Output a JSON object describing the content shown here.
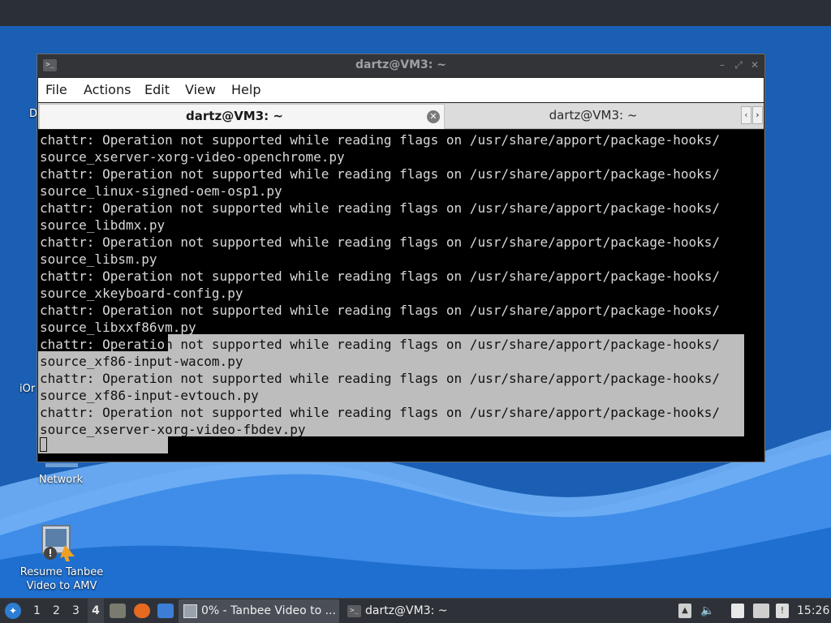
{
  "desktop": {
    "icons": {
      "network_label": "Network",
      "resume_label": "Resume Tanbee Video to AMV",
      "partial_d": "D",
      "partial_iorg": "iOr"
    }
  },
  "window": {
    "title": "dartz@VM3: ~",
    "controls": {
      "minimize": "–",
      "maximize": "⤢",
      "close": "✕"
    }
  },
  "menubar": {
    "file": "File",
    "actions": "Actions",
    "edit": "Edit",
    "view": "View",
    "help": "Help"
  },
  "tabs": [
    {
      "label": "dartz@VM3: ~",
      "active": true
    },
    {
      "label": "dartz@VM3: ~",
      "active": false
    }
  ],
  "terminal": {
    "lines": [
      "chattr: Operation not supported while reading flags on /usr/share/apport/package-hooks/",
      "source_xserver-xorg-video-openchrome.py",
      "chattr: Operation not supported while reading flags on /usr/share/apport/package-hooks/",
      "source_linux-signed-oem-osp1.py",
      "chattr: Operation not supported while reading flags on /usr/share/apport/package-hooks/",
      "source_libdmx.py",
      "chattr: Operation not supported while reading flags on /usr/share/apport/package-hooks/",
      "source_libsm.py",
      "chattr: Operation not supported while reading flags on /usr/share/apport/package-hooks/",
      "source_xkeyboard-config.py",
      "chattr: Operation not supported while reading flags on /usr/share/apport/package-hooks/",
      "source_libxxf86vm.py",
      "chattr: Operation not supported while reading flags on /usr/share/apport/package-hooks/",
      "source_xf86-input-wacom.py",
      "chattr: Operation not supported while reading flags on /usr/share/apport/package-hooks/",
      "source_xf86-input-evtouch.py",
      "chattr: Operation not supported while reading flags on /usr/share/apport/package-hooks/",
      "source_xserver-xorg-video-fbdev.py"
    ]
  },
  "taskbar": {
    "workspaces": [
      "1",
      "2",
      "3",
      "4"
    ],
    "active_workspace": "4",
    "tasks": {
      "tanbee": "0% - Tanbee Video to ...",
      "terminal": "dartz@VM3: ~"
    },
    "clock": "15:26",
    "icons": [
      "start-menu-icon",
      "file-manager-icon",
      "firefox-icon",
      "show-desktop-icon",
      "updates-icon",
      "volume-icon",
      "clipboard-icon",
      "network-icon",
      "alert-icon"
    ]
  },
  "colors": {
    "desktop_bg": "#1565c0",
    "terminal_bg": "#000000",
    "selection": "#bdbdbd",
    "taskbar": "#2e3238"
  }
}
